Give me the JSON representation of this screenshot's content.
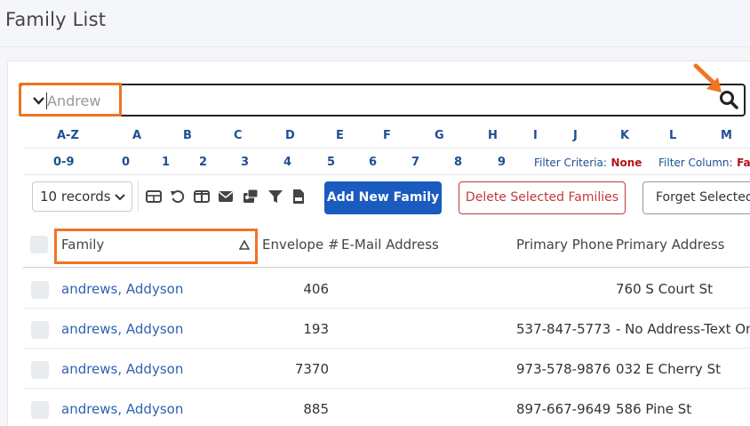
{
  "page": {
    "title": "Family List"
  },
  "search": {
    "value": "Andrew"
  },
  "alphabet": {
    "letters": [
      "A-Z",
      "A",
      "B",
      "C",
      "D",
      "E",
      "F",
      "G",
      "H",
      "I",
      "J",
      "K",
      "L",
      "M"
    ],
    "digits": [
      "0-9",
      "0",
      "1",
      "2",
      "3",
      "4",
      "5",
      "6",
      "7",
      "8",
      "9"
    ]
  },
  "filters": {
    "criteria_label": "Filter Criteria:",
    "criteria_value": "None",
    "column_label": "Filter Column:",
    "column_value": "Fa"
  },
  "toolbar": {
    "records_select": "10 records",
    "icons": [
      "table-icon",
      "undo-icon",
      "columns-icon",
      "envelope-icon",
      "contact-card-icon",
      "filter-icon",
      "csv-file-icon"
    ],
    "add_label": "Add New Family",
    "delete_label": "Delete Selected Families",
    "forget_label": "Forget Selected"
  },
  "table": {
    "headers": [
      "Family",
      "Envelope #",
      "E-Mail Address",
      "Primary Phone",
      "Primary Address"
    ],
    "rows": [
      {
        "family": "andrews, Addyson",
        "envelope": "406",
        "email": "",
        "phone": "",
        "address": "760 S Court St"
      },
      {
        "family": "andrews, Addyson",
        "envelope": "193",
        "email": "",
        "phone": "537-847-5773",
        "address": "- No Address-Text On"
      },
      {
        "family": "andrews, Addyson",
        "envelope": "7370",
        "email": "",
        "phone": "973-578-9876",
        "address": "032 E Cherry St"
      },
      {
        "family": "andrews, Addyson",
        "envelope": "885",
        "email": "",
        "phone": "897-667-9649",
        "address": "586 Pine St"
      }
    ]
  },
  "colors": {
    "accent": "#1a5bbf",
    "highlight": "#f07421",
    "danger": "#c0393b",
    "link": "#2e62b3"
  }
}
